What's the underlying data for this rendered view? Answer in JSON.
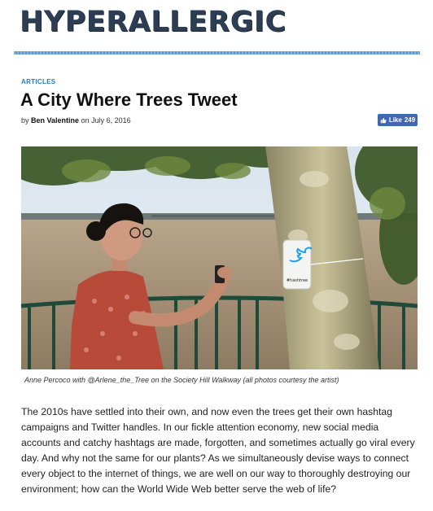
{
  "masthead": {
    "logo_text": "HYPERALLERGIC"
  },
  "article": {
    "category": "ARTICLES",
    "title": "A City Where Trees Tweet",
    "byline_prefix": "by",
    "author": "Ben Valentine",
    "date_prefix": "on",
    "date": "July 6, 2016",
    "like_label": "Like",
    "like_count": "249",
    "photo": {
      "tag_text": "#hashtree"
    },
    "caption": "Anne Percoco with @Arlene_the_Tree on the Society Hill Walkway (all photos courtesy the artist)",
    "body": "The 2010s have settled into their own, and now even the trees get their own hashtag campaigns and Twitter handles. In our fickle attention economy, new social media accounts and catchy hashtags are made, forgotten, and sometimes actually go viral every day. And why not the same for our plants? As we simultaneously devise ways to connect every object to the internet of things, we are well on our way to thoroughly destroying our environment; how can the World Wide Web better serve the web of life?"
  },
  "colors": {
    "logo": "#2d3e54",
    "category": "#1a7fbf",
    "facebook": "#4267b2",
    "rule": "#6aa6d8"
  },
  "icons": {
    "like": "thumbs-up-icon",
    "tag": "twitter-bird-icon"
  }
}
